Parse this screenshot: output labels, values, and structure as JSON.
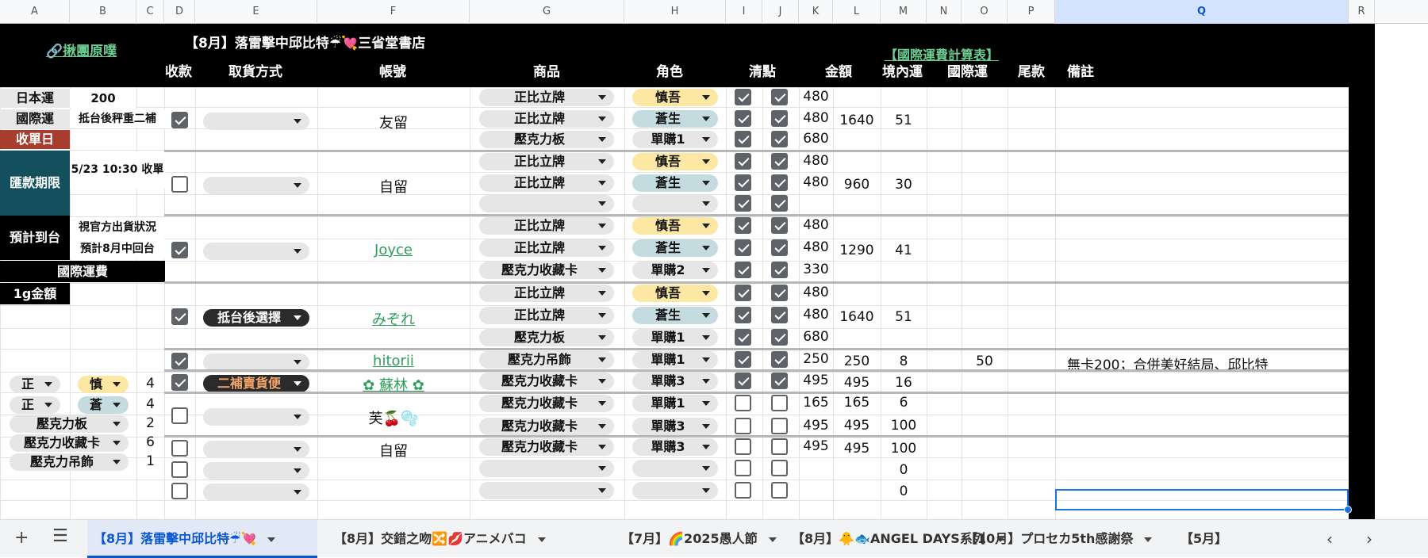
{
  "columns": [
    "A",
    "B",
    "C",
    "D",
    "E",
    "F",
    "G",
    "H",
    "I",
    "J",
    "K",
    "L",
    "M",
    "N",
    "O",
    "P",
    "Q",
    "R"
  ],
  "selected_column": "Q",
  "header": {
    "group_link": "🔗揪團原噗",
    "title": "【8月】落雷擊中邱比特☔💘三省堂書店",
    "intl_link": "【國際運費計算表】",
    "cols": {
      "paid": "收款",
      "pickup": "取貨方式",
      "account": "帳號",
      "product": "商品",
      "role": "角色",
      "check": "清點",
      "amount": "金額",
      "domestic": "境內運",
      "intl": "國際運",
      "balance": "尾款",
      "note": "備註"
    }
  },
  "side": {
    "japan_ship": "日本運",
    "japan_ship_val": "200",
    "intl_ship": "國際運",
    "intl_ship_val": "抵台後秤重二補",
    "close_date": "收單日",
    "pay_deadline": "匯款期限",
    "pay_deadline_val": "5/23 10:30 收單",
    "arrival": "預計到台",
    "arrival_val1": "視官方出貨狀況",
    "arrival_val2": "預計8月中回台",
    "intl_fee": "國際運費",
    "per_gram": "1g金額"
  },
  "left_summary": [
    {
      "a": "正",
      "b": "慎",
      "c": "4"
    },
    {
      "a": "正",
      "b": "蒼",
      "c": "4"
    },
    {
      "a": "壓克力板",
      "c": "2"
    },
    {
      "a": "壓克力收藏卡",
      "c": "6"
    },
    {
      "a": "壓克力吊飾",
      "c": "1"
    }
  ],
  "orders": [
    {
      "paid": true,
      "pickup": "",
      "account": "友留",
      "account_link": false,
      "total": "1640",
      "domestic": "51",
      "intl": "",
      "note": "",
      "items": [
        {
          "product": "正比立牌",
          "role": "慎吾",
          "i": true,
          "j": true,
          "amount": "480"
        },
        {
          "product": "正比立牌",
          "role": "蒼生",
          "i": true,
          "j": true,
          "amount": "480"
        },
        {
          "product": "壓克力板",
          "role": "單購1",
          "i": true,
          "j": true,
          "amount": "680"
        }
      ]
    },
    {
      "paid": false,
      "pickup": "",
      "account": "自留",
      "account_link": false,
      "total": "960",
      "domestic": "30",
      "intl": "",
      "note": "",
      "items": [
        {
          "product": "正比立牌",
          "role": "慎吾",
          "i": true,
          "j": true,
          "amount": "480"
        },
        {
          "product": "正比立牌",
          "role": "蒼生",
          "i": true,
          "j": true,
          "amount": "480"
        },
        {
          "product": "",
          "role": "",
          "i": true,
          "j": true,
          "amount": ""
        }
      ]
    },
    {
      "paid": true,
      "pickup": "",
      "account": "Joyce",
      "account_link": true,
      "total": "1290",
      "domestic": "41",
      "intl": "",
      "note": "",
      "items": [
        {
          "product": "正比立牌",
          "role": "慎吾",
          "i": true,
          "j": true,
          "amount": "480"
        },
        {
          "product": "正比立牌",
          "role": "蒼生",
          "i": true,
          "j": true,
          "amount": "480"
        },
        {
          "product": "壓克力收藏卡",
          "role": "單購2",
          "i": true,
          "j": true,
          "amount": "330"
        }
      ]
    },
    {
      "paid": true,
      "pickup": "抵台後選擇",
      "account": "みぞれ",
      "account_link": true,
      "total": "1640",
      "domestic": "51",
      "intl": "",
      "note": "",
      "items": [
        {
          "product": "正比立牌",
          "role": "慎吾",
          "i": true,
          "j": true,
          "amount": "480"
        },
        {
          "product": "正比立牌",
          "role": "蒼生",
          "i": true,
          "j": true,
          "amount": "480"
        },
        {
          "product": "壓克力板",
          "role": "單購1",
          "i": true,
          "j": true,
          "amount": "680"
        }
      ]
    },
    {
      "paid": true,
      "pickup": "",
      "account": "hitorii",
      "account_link": true,
      "total": "250",
      "domestic": "8",
      "intl": "50",
      "note": "無卡200；合併",
      "note_link1": "美好結局",
      "note_sep": "、",
      "note_link2": "邱比特",
      "items": [
        {
          "product": "壓克力吊飾",
          "role": "單購1",
          "i": true,
          "j": true,
          "amount": "250"
        }
      ]
    },
    {
      "paid": true,
      "pickup": "二補賣貨便",
      "account": "✿ 蘇林 ✿",
      "account_link": true,
      "total": "495",
      "domestic": "16",
      "intl": "",
      "note": "",
      "items": [
        {
          "product": "壓克力收藏卡",
          "role": "單購3",
          "i": true,
          "j": true,
          "amount": "495"
        }
      ]
    },
    {
      "paid": false,
      "pickup": "",
      "account": "芙🍒🫧",
      "account_link": false,
      "total": "",
      "domestic": "",
      "intl": "",
      "note": "",
      "items": [
        {
          "product": "壓克力收藏卡",
          "role": "單購1",
          "i": false,
          "j": false,
          "amount": "165",
          "l": "165",
          "m": "6"
        },
        {
          "product": "壓克力收藏卡",
          "role": "單購3",
          "i": false,
          "j": false,
          "amount": "495",
          "l": "495",
          "m": "100"
        }
      ]
    },
    {
      "paid": false,
      "pickup": "",
      "account": "自留",
      "account_link": false,
      "total": "495",
      "domestic": "100",
      "intl": "",
      "note": "",
      "items": [
        {
          "product": "壓克力收藏卡",
          "role": "單購3",
          "i": false,
          "j": false,
          "amount": "495"
        }
      ]
    },
    {
      "paid": false,
      "pickup": "",
      "account": "",
      "account_link": false,
      "total": "",
      "domestic": "0",
      "intl": "",
      "note": "",
      "items": [
        {
          "product": "",
          "role": "",
          "i": false,
          "j": false,
          "amount": ""
        }
      ]
    },
    {
      "paid": false,
      "pickup": "",
      "account": "",
      "account_link": false,
      "total": "",
      "domestic": "0",
      "intl": "",
      "note": "",
      "items": [
        {
          "product": "",
          "role": "",
          "i": false,
          "j": false,
          "amount": ""
        }
      ]
    }
  ],
  "tabs": [
    {
      "label": "【8月】落雷擊中邱比特☔💘",
      "active": true
    },
    {
      "label": "【8月】交錯之吻🔀💋アニメバコ",
      "active": false
    },
    {
      "label": "【7月】🌈2025愚人節",
      "active": false
    },
    {
      "label": "【8月】🐥🐟ANGEL DAYS系列",
      "active": false
    },
    {
      "label": "【10月】プロセカ5th感謝祭",
      "active": false
    },
    {
      "label": "【5月】",
      "active": false
    }
  ],
  "colors": {
    "close_date_bg": "#a63d2e",
    "deadline_bg": "#134f5c",
    "link": "#2e9e5b",
    "chip_yellow": "#fce7a3",
    "chip_blue": "#c4dbe0",
    "accent": "#1a73e8"
  }
}
